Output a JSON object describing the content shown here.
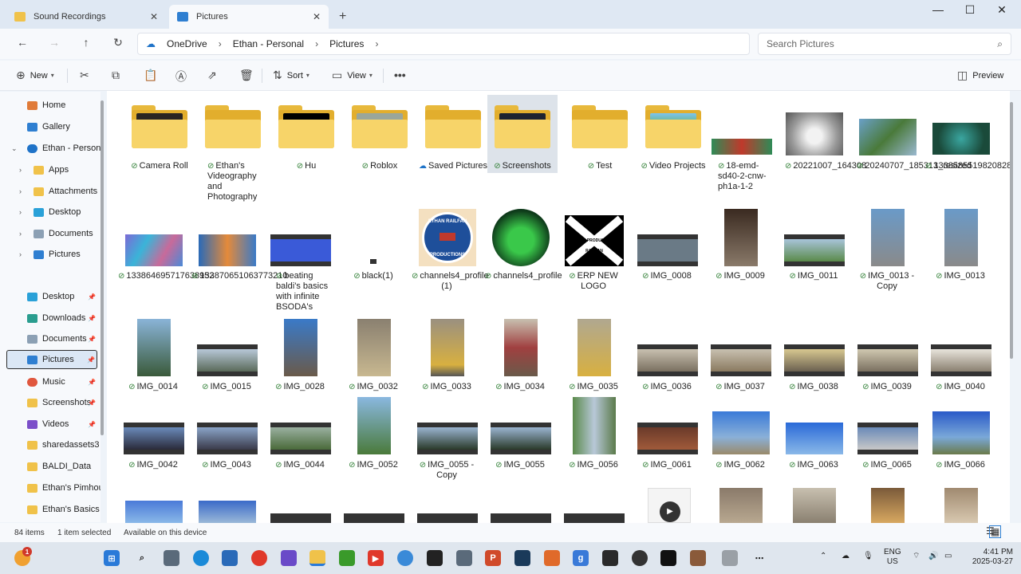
{
  "tabs": [
    {
      "label": "Sound Recordings",
      "active": false
    },
    {
      "label": "Pictures",
      "active": true
    }
  ],
  "nav": {
    "breadcrumb": [
      "OneDrive",
      "Ethan - Personal",
      "Pictures"
    ],
    "search_placeholder": "Search Pictures"
  },
  "toolbar": {
    "new_label": "New",
    "sort_label": "Sort",
    "view_label": "View",
    "preview_label": "Preview"
  },
  "sidebar": {
    "items": [
      {
        "label": "Home",
        "icon": "home-icon",
        "color": "#e07b39"
      },
      {
        "label": "Gallery",
        "icon": "gallery-icon",
        "color": "#2f7fd1"
      },
      {
        "label": "Ethan - Personal",
        "icon": "cloud-icon",
        "color": "#1f73c8"
      },
      {
        "label": "Apps",
        "icon": "folder-icon",
        "color": "#f0c24a"
      },
      {
        "label": "Attachments",
        "icon": "folder-icon",
        "color": "#f0c24a"
      },
      {
        "label": "Desktop",
        "icon": "desktop-icon",
        "color": "#2aa1d8"
      },
      {
        "label": "Documents",
        "icon": "documents-icon",
        "color": "#8ca0b4"
      },
      {
        "label": "Pictures",
        "icon": "pictures-icon",
        "color": "#2f7fd1"
      }
    ],
    "quick": [
      {
        "label": "Desktop",
        "icon": "desktop-icon",
        "color": "#2aa1d8",
        "pinned": true
      },
      {
        "label": "Downloads",
        "icon": "download-icon",
        "color": "#2a9d8f",
        "pinned": true
      },
      {
        "label": "Documents",
        "icon": "documents-icon",
        "color": "#8ca0b4",
        "pinned": true
      },
      {
        "label": "Pictures",
        "icon": "pictures-icon",
        "color": "#2f7fd1",
        "pinned": true
      },
      {
        "label": "Music",
        "icon": "music-icon",
        "color": "#e0573e",
        "pinned": true
      },
      {
        "label": "Screenshots",
        "icon": "folder-icon",
        "color": "#f0c24a",
        "pinned": true
      },
      {
        "label": "Videos",
        "icon": "videos-icon",
        "color": "#7b4fc9",
        "pinned": true
      },
      {
        "label": "sharedassets3",
        "icon": "folder-icon",
        "color": "#f0c24a",
        "pinned": false
      },
      {
        "label": "BALDI_Data",
        "icon": "folder-icon",
        "color": "#f0c24a",
        "pinned": false
      },
      {
        "label": "Ethan's Pimhous",
        "icon": "folder-icon",
        "color": "#f0c24a",
        "pinned": false
      },
      {
        "label": "Ethan's Basics Te",
        "icon": "folder-icon",
        "color": "#f0c24a",
        "pinned": false
      }
    ]
  },
  "files": {
    "row1": [
      "Camera Roll",
      "Ethan's Videography and Photography",
      "Hu",
      "Roblox",
      "Saved Pictures",
      "Screenshots",
      "Test",
      "Video Projects",
      "18-emd-sd40-2-cnw-ph1a-1-2",
      "20221007_164308",
      "20240707_185313_resized",
      "133858551982082851"
    ],
    "row2": [
      "133864695717638952",
      "133870651063773210",
      "beating baldi's basics with infinite BSODA's",
      "black(1)",
      "channels4_profile (1)",
      "channels4_profile",
      "ERP NEW LOGO",
      "IMG_0008",
      "IMG_0009",
      "IMG_0011",
      "IMG_0013 - Copy",
      "IMG_0013"
    ],
    "row3": [
      "IMG_0014",
      "IMG_0015",
      "IMG_0028",
      "IMG_0032",
      "IMG_0033",
      "IMG_0034",
      "IMG_0035",
      "IMG_0036",
      "IMG_0037",
      "IMG_0038",
      "IMG_0039",
      "IMG_0040"
    ],
    "row4": [
      "IMG_0042",
      "IMG_0043",
      "IMG_0044",
      "IMG_0052",
      "IMG_0055 - Copy",
      "IMG_0055",
      "IMG_0056",
      "IMG_0061",
      "IMG_0062",
      "IMG_0063",
      "IMG_0065",
      "IMG_0066"
    ]
  },
  "logos": {
    "railfan_top": "ETHAN RAILFAN",
    "railfan_bottom": "PRODUCTIONS",
    "erp": "ETHAN PRODUCTIONS RAILFAN"
  },
  "status": {
    "count": "84 items",
    "selected": "1 item selected",
    "availability": "Available on this device"
  },
  "taskbar": {
    "notification_count": "1",
    "lang_top": "ENG",
    "lang_bottom": "US",
    "time": "4:41 PM",
    "date": "2025-03-27"
  }
}
